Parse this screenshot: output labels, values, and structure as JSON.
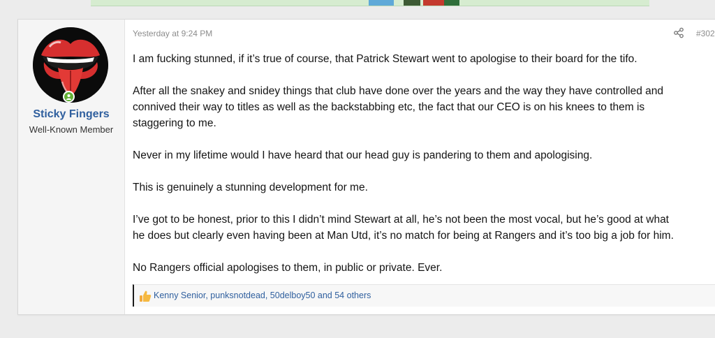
{
  "post": {
    "time": "Yesterday at 9:24 PM",
    "number": "#302",
    "author": {
      "name": "Sticky Fingers",
      "title": "Well-Known Member",
      "online": true,
      "avatar_icon": "rolling-stones-tongue-icon"
    },
    "paragraphs": [
      [
        "I am fucking stunned, if it’s true of course, that Patrick Stewart went to apologise to their board for the tifo."
      ],
      [
        "After all the snakey and snidey things that club have done over the years and the way they have controlled and",
        "connived their way to titles as well as the backstabbing etc, the fact that our CEO is on his knees to them is",
        "staggering to me."
      ],
      [
        "Never in my lifetime would I have heard that our head guy is pandering to them and apologising."
      ],
      [
        "This is genuinely a stunning development for me."
      ],
      [
        "I’ve got to be honest, prior to this I didn’t mind Stewart at all, he’s not been the most vocal, but he’s good at what",
        "he does but clearly even having been at Man Utd, it’s no match for being at Rangers and it’s too big a job for him."
      ],
      [
        "No Rangers official apologises to them, in public or private. Ever."
      ]
    ],
    "reactions": {
      "icon": "thumbs-up-icon",
      "text": "Kenny Senior, punksnotdead, 50delboy50 and 54 others"
    }
  },
  "colors": {
    "page_bg": "#ececec",
    "username": "#2f5f9e",
    "online": "#63b036",
    "link": "#2f5f9e",
    "avatar_red": "#d62f2f"
  }
}
